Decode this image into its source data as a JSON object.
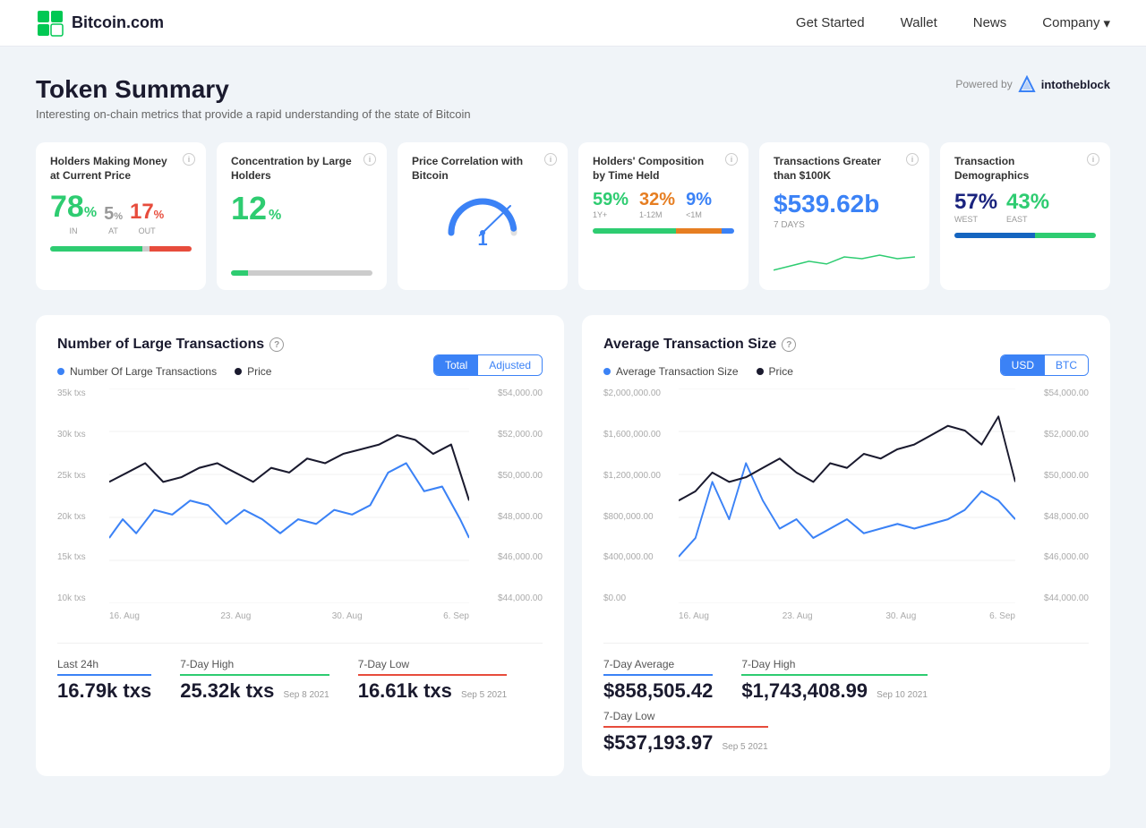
{
  "nav": {
    "logo_text": "Bitcoin.com",
    "links": [
      "Get Started",
      "Wallet",
      "News",
      "Company"
    ]
  },
  "header": {
    "title": "Token Summary",
    "subtitle": "Interesting on-chain metrics that provide a rapid understanding of the state of Bitcoin",
    "powered_by": "Powered by",
    "powered_logo": "intotheblock"
  },
  "metric_cards": [
    {
      "id": "holders-money",
      "title": "Holders Making Money at Current Price",
      "value_in": "78",
      "value_at": "5",
      "value_out": "17",
      "label_in": "IN",
      "label_at": "AT",
      "label_out": "OUT",
      "bar_in_pct": 65,
      "bar_at_pct": 5,
      "bar_out_pct": 30
    },
    {
      "id": "concentration",
      "title": "Concentration by Large Holders",
      "value": "12",
      "bar_pct": 12
    },
    {
      "id": "price-correlation",
      "title": "Price Correlation with Bitcoin",
      "gauge_value": "1"
    },
    {
      "id": "holders-composition",
      "title": "Holders' Composition by Time Held",
      "val_1y": "59",
      "val_12m": "32",
      "val_1m": "9",
      "label_1y": "1Y+",
      "label_12m": "1-12M",
      "label_1m": "<1M",
      "bar_1y": 59,
      "bar_12m": 32,
      "bar_1m": 9
    },
    {
      "id": "transactions-100k",
      "title": "Transactions Greater than $100K",
      "value": "$539.62b",
      "sublabel": "7 DAYS"
    },
    {
      "id": "tx-demographics",
      "title": "Transaction Demographics",
      "val_west": "57",
      "val_east": "43",
      "label_west": "WEST",
      "label_east": "EAST",
      "bar_west": 57,
      "bar_east": 43
    }
  ],
  "chart_left": {
    "title": "Number of Large Transactions",
    "legend_1": "Number Of Large Transactions",
    "legend_2": "Price",
    "toggle_1": "Total",
    "toggle_2": "Adjusted",
    "y_left": [
      "35k txs",
      "30k txs",
      "25k txs",
      "20k txs",
      "15k txs",
      "10k txs"
    ],
    "y_right": [
      "$54,000.00",
      "$52,000.00",
      "$50,000.00",
      "$48,000.00",
      "$46,000.00",
      "$44,000.00"
    ],
    "x_labels": [
      "16. Aug",
      "23. Aug",
      "30. Aug",
      "6. Sep"
    ],
    "stats": [
      {
        "label": "Last 24h",
        "line_color": "blue-line",
        "value": "16.79k txs",
        "date": ""
      },
      {
        "label": "7-Day High",
        "line_color": "green-line",
        "value": "25.32k txs",
        "date": "Sep 8 2021"
      },
      {
        "label": "7-Day Low",
        "line_color": "red-line",
        "value": "16.61k txs",
        "date": "Sep 5 2021"
      }
    ]
  },
  "chart_right": {
    "title": "Average Transaction Size",
    "legend_1": "Average Transaction Size",
    "legend_2": "Price",
    "toggle_1": "USD",
    "toggle_2": "BTC",
    "y_left": [
      "$2,000,000.00",
      "$1,600,000.00",
      "$1,200,000.00",
      "$800,000.00",
      "$400,000.00",
      "$0.00"
    ],
    "y_right": [
      "$54,000.00",
      "$52,000.00",
      "$50,000.00",
      "$48,000.00",
      "$46,000.00",
      "$44,000.00"
    ],
    "x_labels": [
      "16. Aug",
      "23. Aug",
      "30. Aug",
      "6. Sep"
    ],
    "stats": [
      {
        "label": "7-Day Average",
        "line_color": "blue-line",
        "value": "$858,505.42",
        "date": ""
      },
      {
        "label": "7-Day High",
        "line_color": "green-line",
        "value": "$1,743,408.99",
        "date": "Sep 10 2021"
      },
      {
        "label": "7-Day Low",
        "line_color": "red-line",
        "value": "$537,193.97",
        "date": "Sep 5 2021"
      }
    ]
  }
}
